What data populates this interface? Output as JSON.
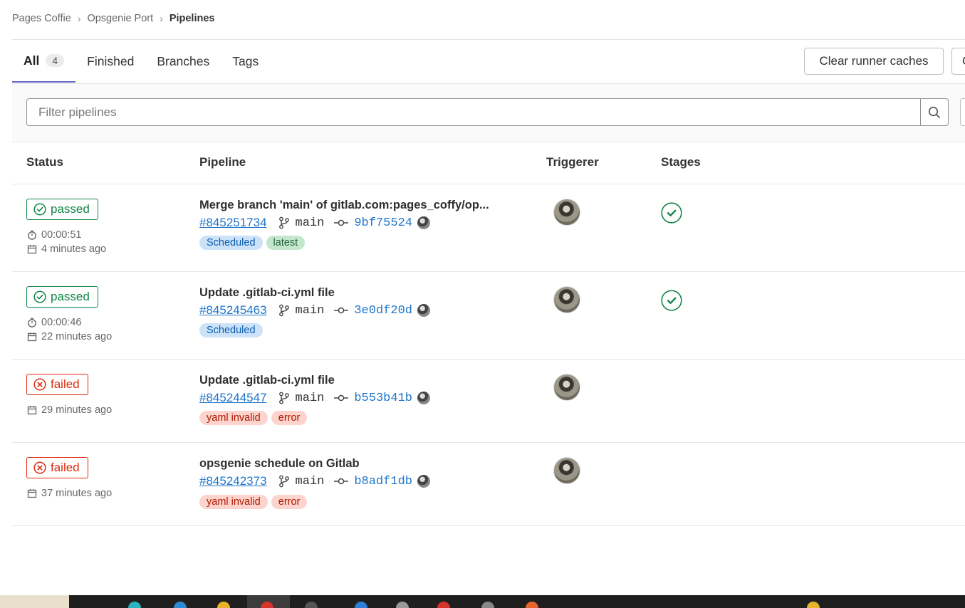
{
  "breadcrumb": {
    "items": [
      "Pages Coffie",
      "Opsgenie Port"
    ],
    "current": "Pipelines"
  },
  "tabs": [
    {
      "label": "All",
      "count": "4"
    },
    {
      "label": "Finished"
    },
    {
      "label": "Branches"
    },
    {
      "label": "Tags"
    }
  ],
  "actions": {
    "clear_caches": "Clear runner caches",
    "more_partial": "C"
  },
  "filter": {
    "placeholder": "Filter pipelines"
  },
  "table": {
    "headers": {
      "status": "Status",
      "pipeline": "Pipeline",
      "triggerer": "Triggerer",
      "stages": "Stages"
    },
    "rows": [
      {
        "status": "passed",
        "duration": "00:00:51",
        "finished": "4 minutes ago",
        "title": "Merge branch 'main' of gitlab.com:pages_coffy/op...",
        "id": "#845251734",
        "branch": "main",
        "sha": "9bf75524",
        "labels": [
          {
            "text": "Scheduled",
            "kind": "blue"
          },
          {
            "text": "latest",
            "kind": "green"
          }
        ],
        "stage": "success"
      },
      {
        "status": "passed",
        "duration": "00:00:46",
        "finished": "22 minutes ago",
        "title": "Update .gitlab-ci.yml file",
        "id": "#845245463",
        "branch": "main",
        "sha": "3e0df20d",
        "labels": [
          {
            "text": "Scheduled",
            "kind": "blue"
          }
        ],
        "stage": "success"
      },
      {
        "status": "failed",
        "finished": "29 minutes ago",
        "title": "Update .gitlab-ci.yml file",
        "id": "#845244547",
        "branch": "main",
        "sha": "b553b41b",
        "labels": [
          {
            "text": "yaml invalid",
            "kind": "red"
          },
          {
            "text": "error",
            "kind": "red"
          }
        ]
      },
      {
        "status": "failed",
        "finished": "37 minutes ago",
        "title": "opsgenie schedule on Gitlab",
        "id": "#845242373",
        "branch": "main",
        "sha": "b8adf1db",
        "labels": [
          {
            "text": "yaml invalid",
            "kind": "red"
          },
          {
            "text": "error",
            "kind": "red"
          }
        ]
      }
    ]
  },
  "colors": {
    "passed": "#108548",
    "failed": "#dd2b0e",
    "link": "#1f75cb",
    "tab_active": "#6666c4"
  }
}
